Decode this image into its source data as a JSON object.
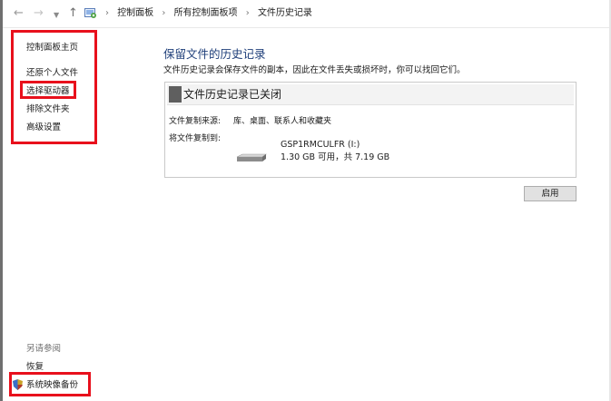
{
  "address_bar": {
    "back_glyph": "←",
    "forward_glyph": "→",
    "recent_glyph": "⌄",
    "up_glyph": "↑",
    "crumbs": [
      "控制面板",
      "所有控制面板项",
      "文件历史记录"
    ],
    "separator": "›",
    "icon": "control-panel-icon"
  },
  "sidebar": {
    "items": [
      {
        "label": "控制面板主页"
      },
      {
        "label": "还原个人文件"
      },
      {
        "label": "选择驱动器"
      },
      {
        "label": "排除文件夹"
      },
      {
        "label": "高级设置"
      }
    ],
    "see_also_heading": "另请参阅",
    "see_also": [
      {
        "label": "恢复"
      },
      {
        "label": "系统映像备份",
        "icon": "shield-icon"
      }
    ]
  },
  "main": {
    "title": "保留文件的历史记录",
    "description": "文件历史记录会保存文件的副本，因此在文件丢失或损坏时，你可以找回它们。",
    "status": "文件历史记录已关闭",
    "copy_from_label": "文件复制来源:",
    "copy_from_value": "库、桌面、联系人和收藏夹",
    "copy_to_label": "将文件复制到:",
    "drive": {
      "name": "GSP1RMCULFR (I:)",
      "space": "1.30 GB 可用，共 7.19 GB",
      "icon": "usb-drive-icon"
    },
    "enable_button": "启用"
  },
  "colors": {
    "highlight_box": "#e8101c",
    "title_blue": "#1f3f7a"
  }
}
